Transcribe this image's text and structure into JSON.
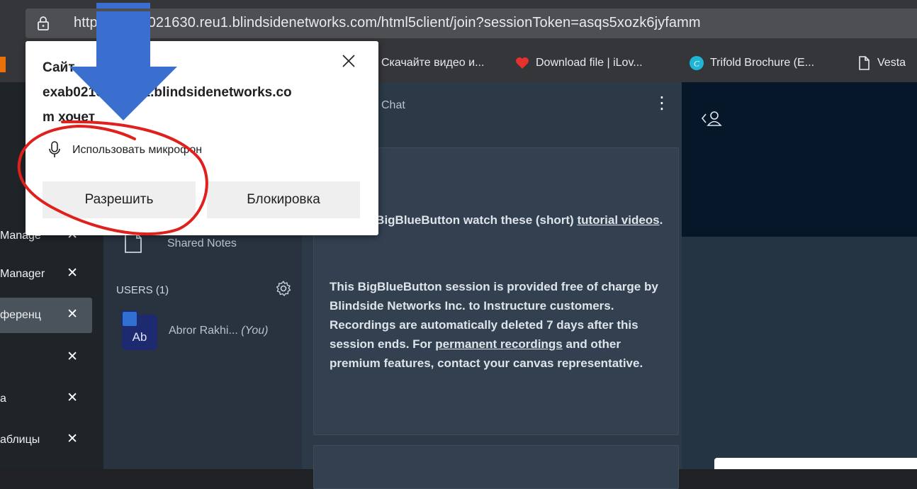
{
  "browser": {
    "url": "https://exab021630.reu1.blindsidenetworks.com/html5client/join?sessionToken=asqs5xozk6jyfamm",
    "url_visible": "https://exab021630.reu1.blindsidenetworks.com/html5client/join?sessionToken=asqs5xozk6jyfamm",
    "bookmarks": [
      {
        "label": "Скачайте видео и...",
        "icon": "video-icon"
      },
      {
        "label": "Download file | iLov...",
        "icon": "heart-icon"
      },
      {
        "label": "Trifold Brochure (E...",
        "icon": "canva-icon"
      },
      {
        "label": "Vesta",
        "icon": "document-icon"
      }
    ]
  },
  "left_tabs": [
    {
      "label": "Manage",
      "close": "✕"
    },
    {
      "label": "Manager",
      "close": "✕"
    },
    {
      "label": "ференц",
      "close": "✕"
    },
    {
      "label": "",
      "close": "✕"
    },
    {
      "label": "а",
      "close": "✕"
    },
    {
      "label": "аблицы",
      "close": "✕"
    }
  ],
  "users_panel": {
    "shared_notes": "Shared Notes",
    "users_header": "USERS (1)",
    "user": {
      "initials": "Ab",
      "name": "Abror Rakhi...",
      "you": "(You)"
    }
  },
  "chat": {
    "title": "Chat",
    "message1_pre": "p using BigBlueButton watch these (short) ",
    "message1_link": "tutorial videos",
    "message1_post": ".",
    "message2_a": "This BigBlueButton session is provided free of charge by Blindside Networks Inc. to Instructure customers. Recordings are automatically deleted 7 days after this session ends. For ",
    "message2_link": "permanent recordings",
    "message2_b": " and other premium features, contact your canvas representative."
  },
  "popup": {
    "title_line1": "Сайт",
    "title_line2": "exab021630.reu1.blindsidenetworks.co",
    "title_line3": "m хочет",
    "permission": "Использовать микрофон",
    "allow": "Разрешить",
    "block": "Блокировка"
  },
  "colors": {
    "annotation_arrow": "#3a6fcf",
    "annotation_circle": "#e0201c"
  }
}
